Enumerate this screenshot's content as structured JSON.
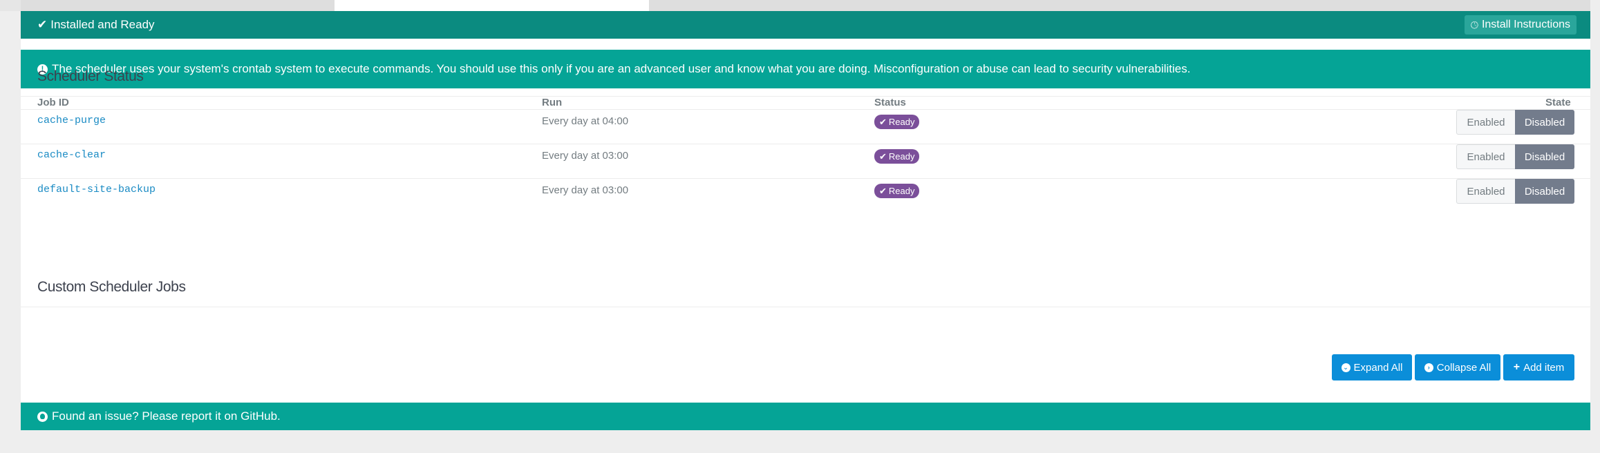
{
  "status_bar": {
    "text": "Installed and Ready",
    "install_button": "Install Instructions"
  },
  "notice": {
    "text": "The scheduler uses your system's crontab system to execute commands. You should use this only if you are an advanced user and know what you are doing. Misconfiguration or abuse can lead to security vulnerabilities."
  },
  "scheduler_status": {
    "title": "Scheduler Status",
    "columns": [
      "Job ID",
      "Run",
      "Status",
      "State"
    ],
    "rows": [
      {
        "job_id": "cache-purge",
        "run": "Every day at 04:00",
        "status": "Ready",
        "enabled_label": "Enabled",
        "disabled_label": "Disabled",
        "state": "Disabled"
      },
      {
        "job_id": "cache-clear",
        "run": "Every day at 03:00",
        "status": "Ready",
        "enabled_label": "Enabled",
        "disabled_label": "Disabled",
        "state": "Disabled"
      },
      {
        "job_id": "default-site-backup",
        "run": "Every day at 03:00",
        "status": "Ready",
        "enabled_label": "Enabled",
        "disabled_label": "Disabled",
        "state": "Disabled"
      }
    ]
  },
  "custom_jobs": {
    "title": "Custom Scheduler Jobs",
    "expand_all": "Expand All",
    "collapse_all": "Collapse All",
    "add_item": "Add item"
  },
  "footer": {
    "text": "Found an issue? Please report it on GitHub."
  },
  "colors": {
    "status_bar": "#0b8b80",
    "notice": "#05a496",
    "badge": "#7b4f9a",
    "disabled_toggle": "#737c8c",
    "primary_button": "#0b8ed9",
    "link": "#1a8bc4"
  },
  "icons": {
    "status": "check-icon",
    "install": "clock-icon",
    "notice": "exclamation-circle-icon",
    "badge": "check-icon",
    "expand": "chevron-circle-down-icon",
    "collapse": "chevron-circle-right-icon",
    "add": "plus-icon",
    "footer": "github-icon"
  }
}
